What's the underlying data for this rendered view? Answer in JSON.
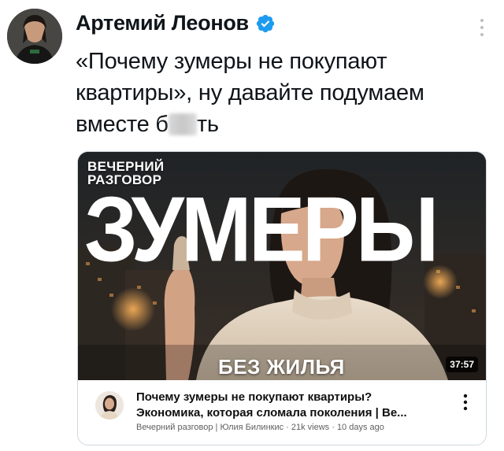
{
  "tweet": {
    "author_name": "Артемий Леонов",
    "text_line1": "«Почему зумеры не покупают",
    "text_line2": "квартиры», ну давайте подумаем",
    "text_line3_start": "вместе б",
    "text_line3_end": "ть"
  },
  "video": {
    "show_name": "ВЕЧЕРНИЙ\nРАЗГОВОР",
    "big_title": "ЗУМЕРЫ",
    "subtitle": "БЕЗ ЖИЛЬЯ",
    "duration": "37:57",
    "title_line1": "Почему зумеры не покупают квартиры?",
    "title_line2": "Экономика, которая сломала поколения | Ве...",
    "meta": "Вечерний разговор | Юлия Билинкис · 21k views · 10 days ago"
  },
  "icons": {
    "verified": "verified-badge-icon",
    "more": "more-vertical-icon"
  },
  "colors": {
    "verified_blue": "#1d9bf0",
    "text": "#0f1419",
    "meta_gray": "#606060"
  }
}
